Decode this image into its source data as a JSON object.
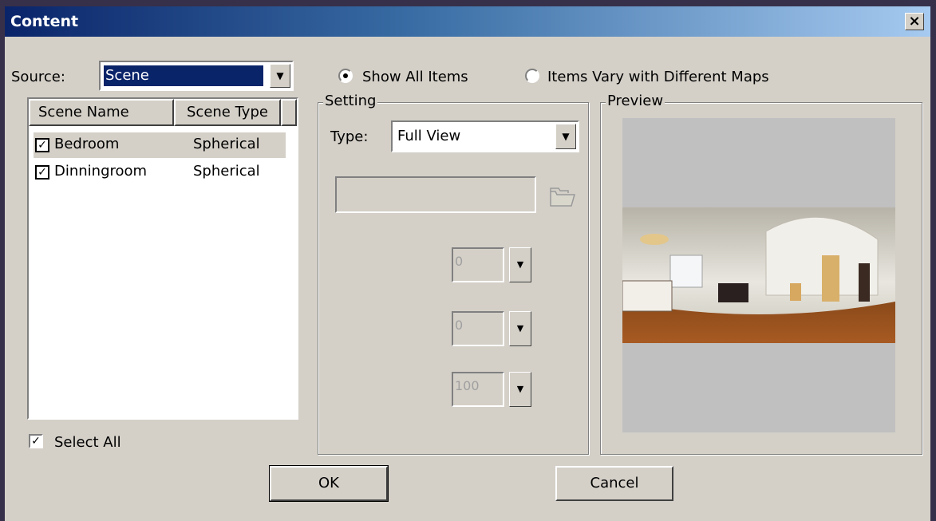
{
  "window": {
    "title": "Content",
    "close_label": "×"
  },
  "source": {
    "label": "Source:",
    "value": "Scene"
  },
  "mode": {
    "option1": "Show All Items",
    "option2": "Items Vary with Different Maps",
    "selected": "Show All Items"
  },
  "scene_list": {
    "columns": [
      "Scene Name",
      "Scene Type"
    ],
    "rows": [
      {
        "name": "Bedroom",
        "type": "Spherical",
        "checked": true
      },
      {
        "name": "Dinningroom",
        "type": "Spherical",
        "checked": true
      }
    ]
  },
  "select_all": {
    "label": "Select All",
    "checked": true
  },
  "setting": {
    "group_label": "Setting",
    "type_label": "Type:",
    "type_value": "Full View",
    "path_value": "",
    "spin1": "0",
    "spin2": "0",
    "spin3": "100"
  },
  "preview": {
    "group_label": "Preview"
  },
  "buttons": {
    "ok": "OK",
    "cancel": "Cancel"
  },
  "colors": {
    "title_start": "#0a246a",
    "title_end": "#a6caf0",
    "dialog_bg": "#d4d0c8",
    "selection": "#0a246a"
  }
}
